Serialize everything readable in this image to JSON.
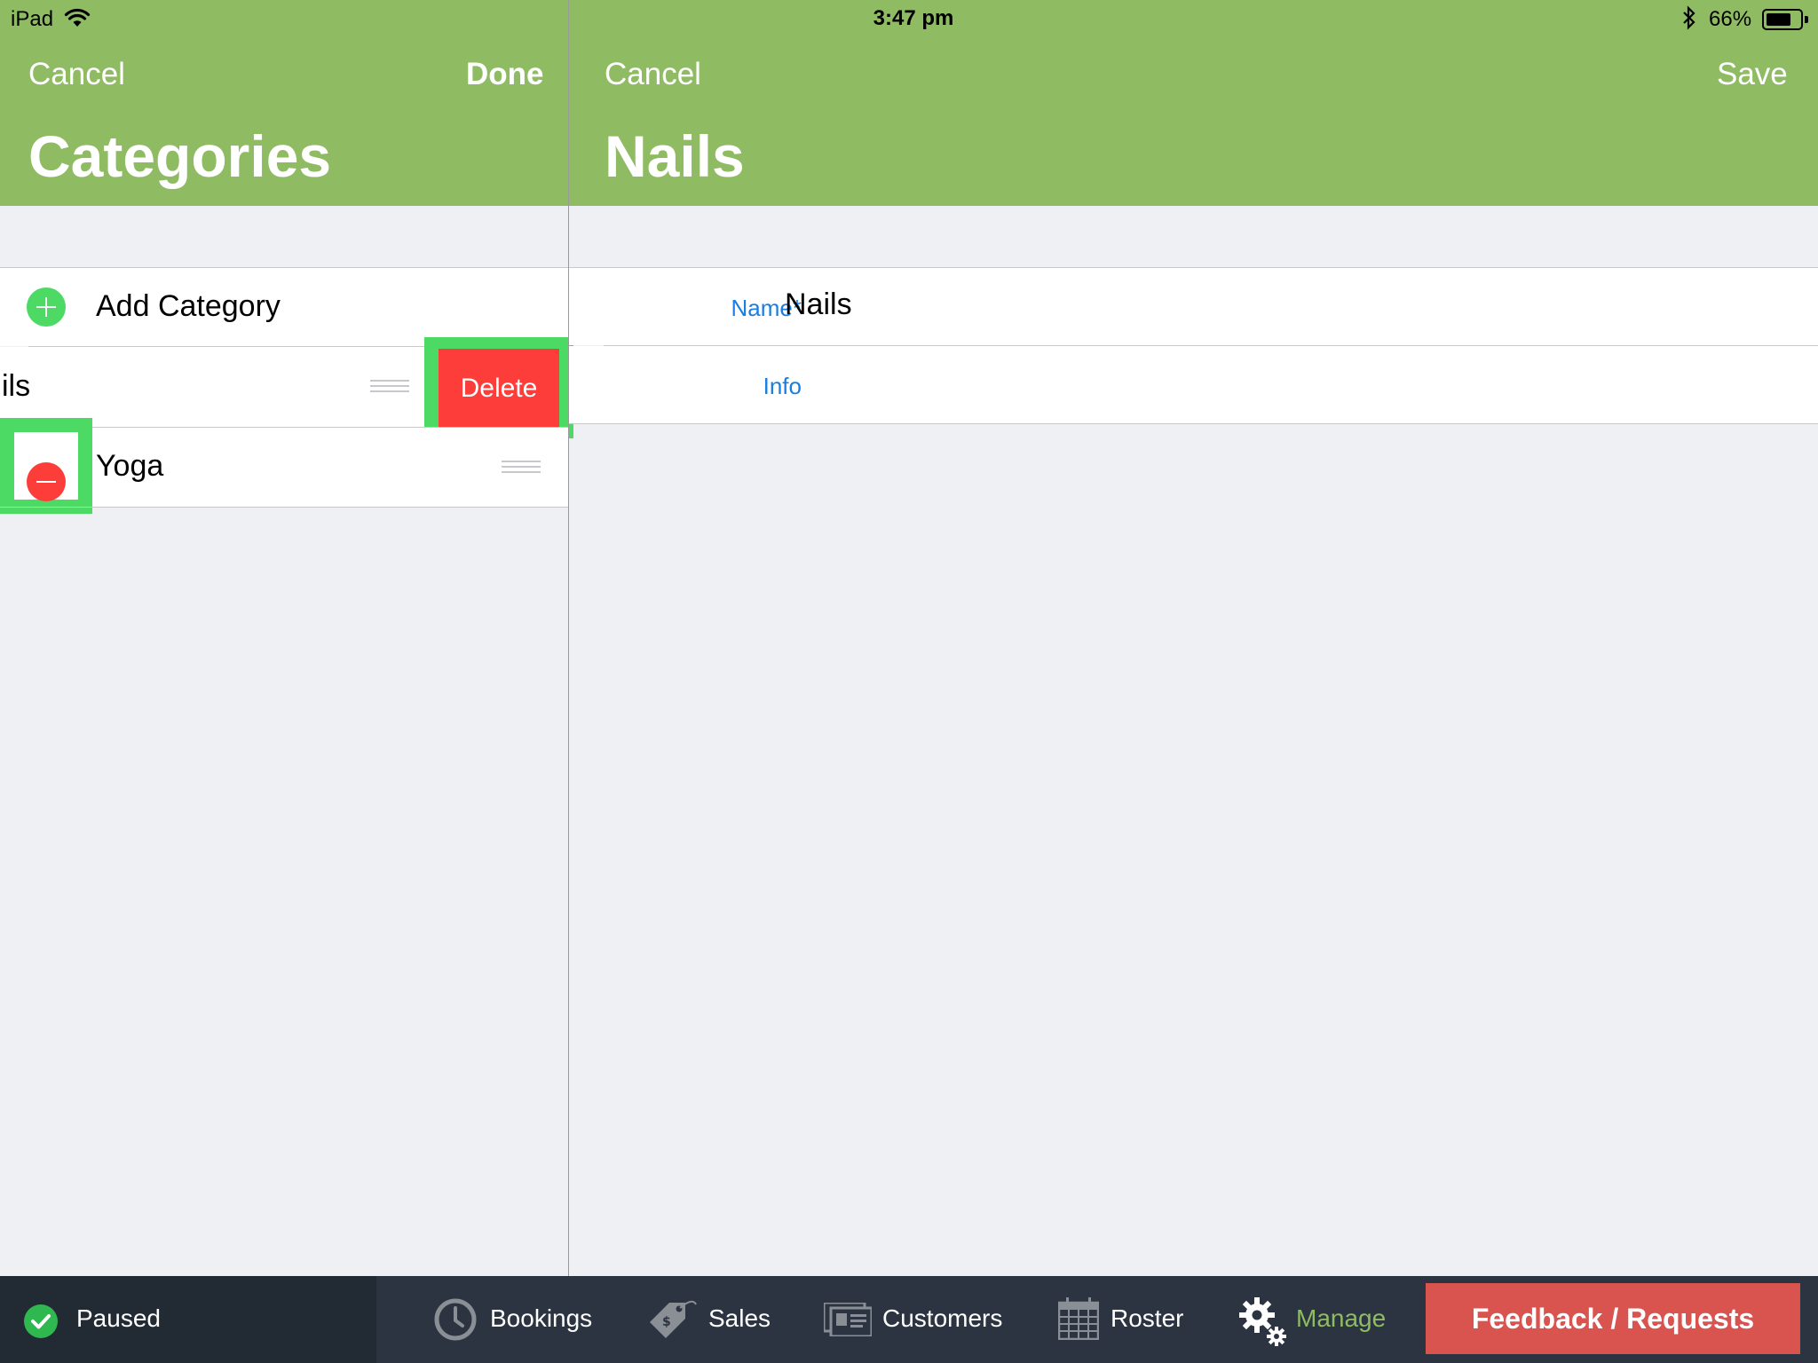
{
  "status_bar": {
    "device": "iPad",
    "time": "3:47 pm",
    "battery": "66%",
    "battery_level": 0.66
  },
  "left": {
    "cancel": "Cancel",
    "done": "Done",
    "title": "Categories",
    "add_category": "Add Category",
    "items": [
      {
        "label": "ils",
        "delete_label": "Delete"
      },
      {
        "label": "Yoga"
      }
    ]
  },
  "right": {
    "cancel": "Cancel",
    "save": "Save",
    "title": "Nails",
    "fields": [
      {
        "label": "Name*",
        "value": "Nails"
      },
      {
        "label": "Info",
        "value": ""
      }
    ]
  },
  "tabbar": {
    "status": "Paused",
    "tabs": [
      {
        "label": "Bookings",
        "icon": "clock-icon"
      },
      {
        "label": "Sales",
        "icon": "price-tag-icon"
      },
      {
        "label": "Customers",
        "icon": "customers-icon"
      },
      {
        "label": "Roster",
        "icon": "calendar-icon"
      },
      {
        "label": "Manage",
        "icon": "gears-icon",
        "active": true
      }
    ],
    "feedback": "Feedback / Requests"
  },
  "colors": {
    "header": "#8fbb63",
    "delete": "#fc3d39",
    "add": "#4cd964",
    "link": "#1a7ee0",
    "tabbar": "#2b3440",
    "active_tab": "#8fbb63",
    "feedback": "#d9534f"
  }
}
